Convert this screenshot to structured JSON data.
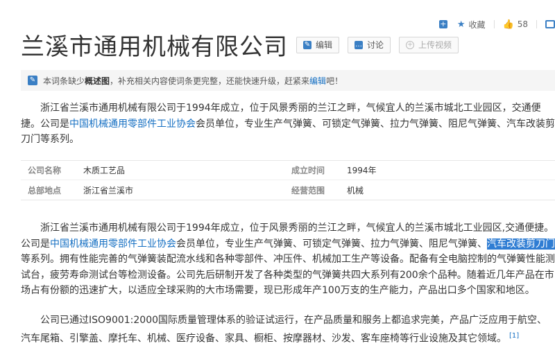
{
  "toolbar": {
    "favorite_label": "收藏",
    "like_count": "58"
  },
  "entry": {
    "title": "兰溪市通用机械有限公司",
    "edit_label": "编辑",
    "discuss_label": "讨论",
    "upload_video_label": "上传视频"
  },
  "notice": {
    "prefix": "本词条缺少",
    "bold": "概述图",
    "middle": "，补充相关内容使词条更完整，还能快速升级，赶紧来",
    "link": "编辑",
    "suffix": "吧！"
  },
  "summary": {
    "p1a": "浙江省兰溪市通用机械有限公司于1994年成立，位于风景秀丽的兰江之畔，气候宜人的兰溪市城北工业园区，交通便捷。公司是",
    "p1link": "中国机械通用零部件工业协会",
    "p1b": "会员单位，专业生产气弹簧、可锁定气弹簧、拉力气弹簧、阻尼气弹簧、汽车改装剪刀门等系列。"
  },
  "infobox": {
    "rows": [
      {
        "k1": "公司名称",
        "v1": "木质工艺品",
        "k2": "成立时间",
        "v2": "1994年"
      },
      {
        "k1": "总部地点",
        "v1": "浙江省兰溪市",
        "k2": "经营范围",
        "v2": "机械"
      }
    ]
  },
  "body": {
    "p2a": "浙江省兰溪市通用机械有限公司于1994年成立，位于风景秀丽的兰江之畔，气候宜人的兰溪市城北工业园区,交通便捷。公司是",
    "p2link": "中国机械通用零部件工业协会",
    "p2b": "会员单位，专业生产气弹簧、可锁定气弹簧、拉力气弹簧、阻尼气弹簧、",
    "p2hl": "汽车改装剪刀门",
    "p2c": "等系列。拥有性能完善的气弹簧装配流水线和各种零部件、冲压件、机械加工生产等设备。配备有全电脑控制的气弹簧性能测试台，疲劳寿命测试台等检测设备。公司先后研制开发了各种类型的气弹簧共四大系列有200余个品种。随着近几年产品在市场占有份额的迅速扩大，以适应全球采购的大市场需要，现已形成年产100万支的生产能力，产品出口多个国家和地区。",
    "p3": "公司已通过ISO9001:2000国际质量管理体系的验证试运行，在产品质量和服务上都追求完美，产品广泛应用于航空、汽车尾箱、引擎盖、摩托车、机械、医疗设备、家具、橱柜、按摩器材、沙发、客车座椅等行业设施及其它领域。",
    "p3ref": "[1]"
  },
  "colors": {
    "link": "#136ec2",
    "accent": "#3a7fc4",
    "highlight": "#2f7dd3"
  }
}
